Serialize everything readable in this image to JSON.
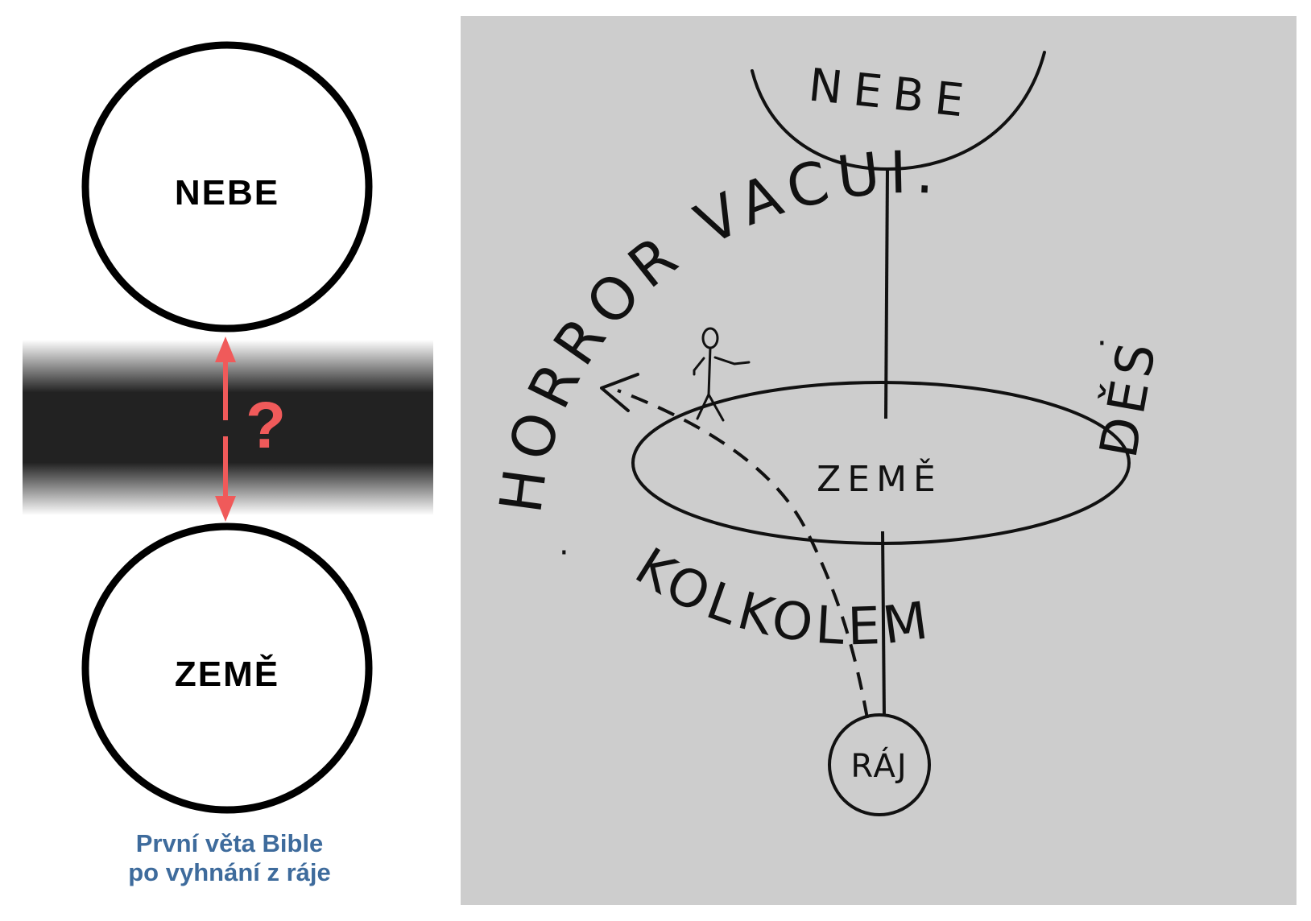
{
  "left": {
    "top_circle_label": "NEBE",
    "bottom_circle_label": "ZEMĚ",
    "question_mark": "?",
    "caption_line1": "První věta Bible",
    "caption_line2": "po vyhnání z ráje"
  },
  "sketch": {
    "heaven_label": "NEBE",
    "earth_label": "ZEMĚ",
    "paradise_label": "RÁJ",
    "ring_text_upper": "HORROR VACUI.",
    "ring_text_right": "DĚS",
    "ring_text_lower": "KOLKOLEM"
  },
  "colors": {
    "arrow": "#f05a5a",
    "caption": "#3e6b9c",
    "band": "#222222",
    "sketch_bg": "#cdcdcd"
  }
}
